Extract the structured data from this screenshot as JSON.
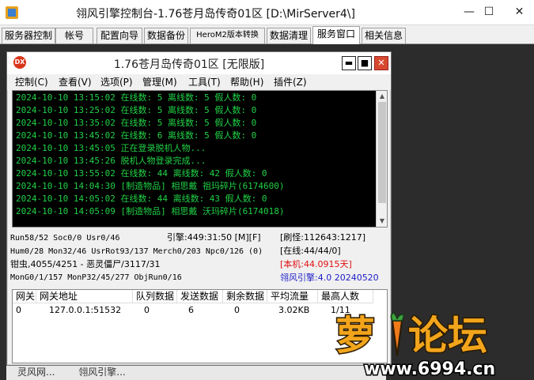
{
  "window": {
    "title": "翎风引擎控制台-1.76苍月岛传奇01区 [D:\\MirServer4\\]",
    "min": "—",
    "max": "☐",
    "close": "✕"
  },
  "tabs": [
    {
      "label": "服务器控制"
    },
    {
      "label": "帐号"
    },
    {
      "label": "配置向导"
    },
    {
      "label": "数据备份"
    },
    {
      "label": "HeroM2版本转换"
    },
    {
      "label": "数据清理"
    },
    {
      "label": "服务窗口"
    },
    {
      "label": "相关信息"
    }
  ],
  "inner": {
    "title": "1.76苍月岛传奇01区 [无限版]",
    "icon_text": "DX",
    "btn_min": "▬",
    "btn_max": "■",
    "btn_close": "✕",
    "menu": [
      "控制(C)",
      "查看(V)",
      "选项(P)",
      "管理(M)",
      "工具(T)",
      "帮助(H)",
      "插件(Z)"
    ]
  },
  "log_lines": [
    "2024-10-10 13:15:02 在线数: 5 离线数: 5 假人数: 0",
    "2024-10-10 13:25:02 在线数: 5 离线数: 5 假人数: 0",
    "2024-10-10 13:35:02 在线数: 5 离线数: 5 假人数: 0",
    "2024-10-10 13:45:02 在线数: 6 离线数: 5 假人数: 0",
    "2024-10-10 13:45:05 正在登录脱机人物...",
    "2024-10-10 13:45:26 脱机人物登录完成...",
    "2024-10-10 13:55:02 在线数: 44 离线数: 42 假人数: 0",
    "2024-10-10 14:04:30 [制造物品] 相思戴 祖玛碎片(6174600)",
    "2024-10-10 14:05:02 在线数: 44 离线数: 43 假人数: 0",
    "2024-10-10 14:05:09 [制造物品] 相思戴 沃玛碎片(6174018)"
  ],
  "status": {
    "line1_left": "Run58/52 Soc0/0 Usr0/46",
    "line1_mid": "引擎:449:31:50 [M][F]",
    "line1_right": "[刷怪:112643:1217]",
    "line2_left": "Hum0/28 Mon32/46 UsrRot93/137 Merch0/203 Npc0/126 (0)",
    "line2_right": "[在线:44/44/0]",
    "line3_left": "钳虫,4055/4251 - 恶灵僵尸/3117/31",
    "line3_right": "[本机:44.0915天]",
    "line4_left": "MonG0/1/157 MonP32/45/277 ObjRun0/16",
    "line4_right": "翎风引擎:4.0 20240520"
  },
  "table": {
    "headers": [
      "网关",
      "网关地址",
      "队列数据",
      "发送数据",
      "剩余数据",
      "平均流量",
      "最高人数"
    ],
    "rows": [
      [
        "0",
        "127.0.0.1:51532",
        "0",
        "6",
        "0",
        "3.02KB",
        "1/11"
      ]
    ]
  },
  "bottom_strip": [
    "灵风网...",
    "翎风引擎..."
  ],
  "watermark": {
    "text": "萝卜论坛",
    "url": "www.6994.cn"
  },
  "colors": {
    "log_text": "#21d146",
    "red": "#e01010",
    "blue": "#1e1ec8",
    "close_red": "#d7492f"
  }
}
